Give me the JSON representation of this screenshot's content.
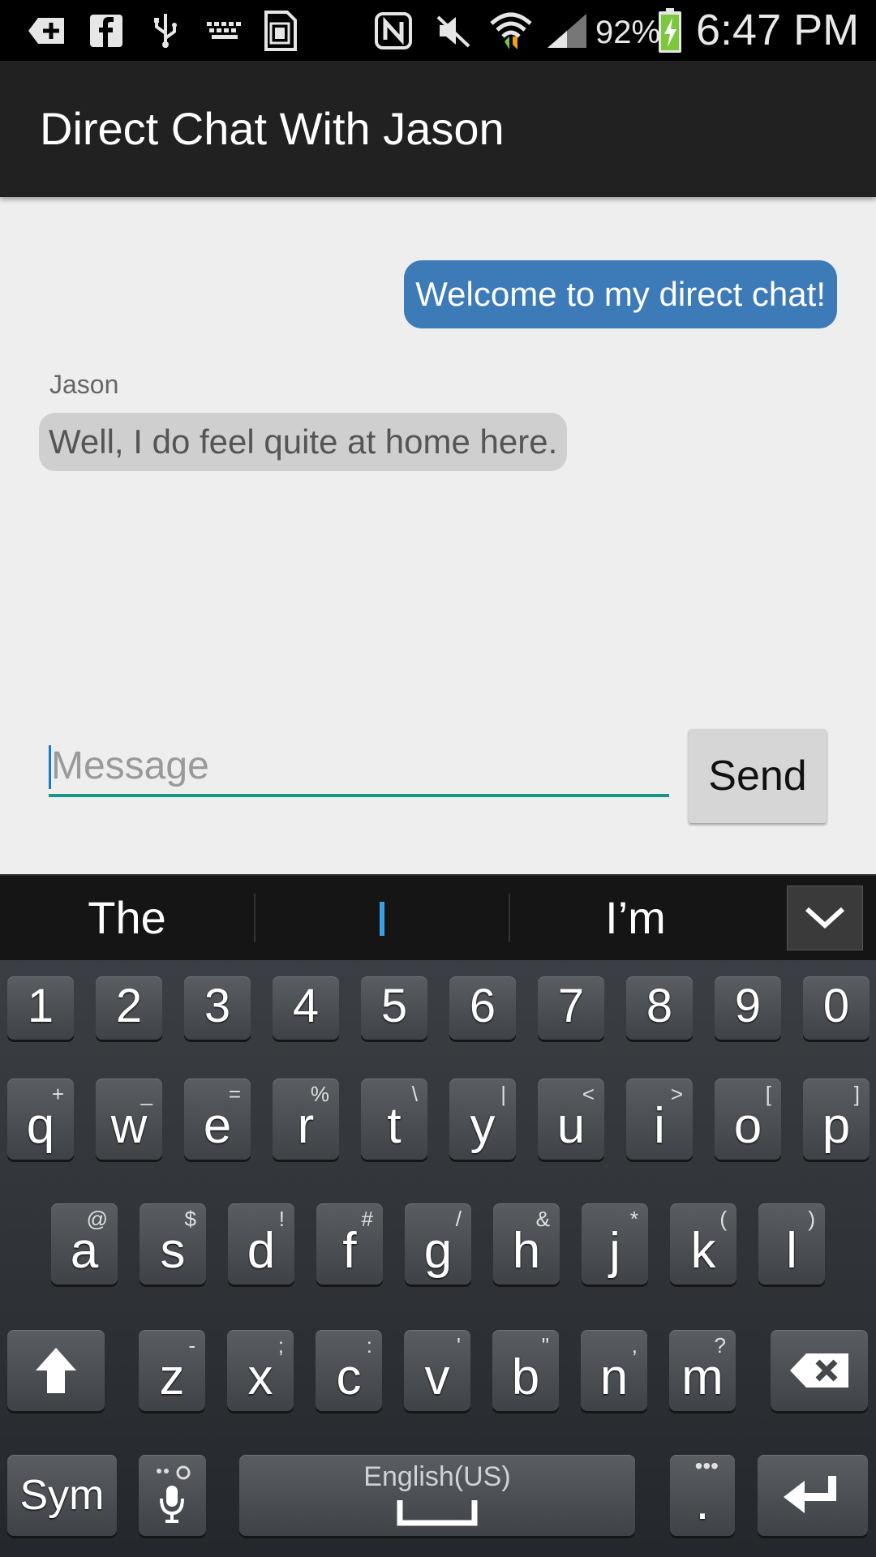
{
  "status_bar": {
    "battery": "92%",
    "time": "6:47 PM",
    "icons": [
      "add-box-icon",
      "facebook-icon",
      "usb-icon",
      "keyboard-icon",
      "sim-card-icon",
      "nfc-icon",
      "mute-icon",
      "wifi-icon",
      "signal-icon",
      "battery-charging-icon"
    ]
  },
  "app_bar": {
    "title": "Direct Chat With Jason"
  },
  "chat": {
    "messages": [
      {
        "direction": "outgoing",
        "text": "Welcome to my direct chat!"
      },
      {
        "direction": "incoming",
        "sender": "Jason",
        "text": "Well, I do feel quite at home here."
      }
    ],
    "input": {
      "placeholder": "Message",
      "value": ""
    },
    "send_label": "Send"
  },
  "suggestions": [
    "The",
    "I",
    "I’m"
  ],
  "keyboard": {
    "number_row": [
      "1",
      "2",
      "3",
      "4",
      "5",
      "6",
      "7",
      "8",
      "9",
      "0"
    ],
    "row1": [
      {
        "key": "q",
        "hint": "+"
      },
      {
        "key": "w",
        "hint": "_"
      },
      {
        "key": "e",
        "hint": "="
      },
      {
        "key": "r",
        "hint": "%"
      },
      {
        "key": "t",
        "hint": "\\"
      },
      {
        "key": "y",
        "hint": "|"
      },
      {
        "key": "u",
        "hint": "<"
      },
      {
        "key": "i",
        "hint": ">"
      },
      {
        "key": "o",
        "hint": "["
      },
      {
        "key": "p",
        "hint": "]"
      }
    ],
    "row2": [
      {
        "key": "a",
        "hint": "@"
      },
      {
        "key": "s",
        "hint": "$"
      },
      {
        "key": "d",
        "hint": "!"
      },
      {
        "key": "f",
        "hint": "#"
      },
      {
        "key": "g",
        "hint": "/"
      },
      {
        "key": "h",
        "hint": "&"
      },
      {
        "key": "j",
        "hint": "*"
      },
      {
        "key": "k",
        "hint": "("
      },
      {
        "key": "l",
        "hint": ")"
      }
    ],
    "row3": [
      {
        "key": "z",
        "hint": "-"
      },
      {
        "key": "x",
        "hint": ";"
      },
      {
        "key": "c",
        "hint": ":"
      },
      {
        "key": "v",
        "hint": "'"
      },
      {
        "key": "b",
        "hint": "\""
      },
      {
        "key": "n",
        "hint": ","
      },
      {
        "key": "m",
        "hint": "?"
      }
    ],
    "sym_label": "Sym",
    "space_label": "English(US)",
    "period_label": "."
  }
}
